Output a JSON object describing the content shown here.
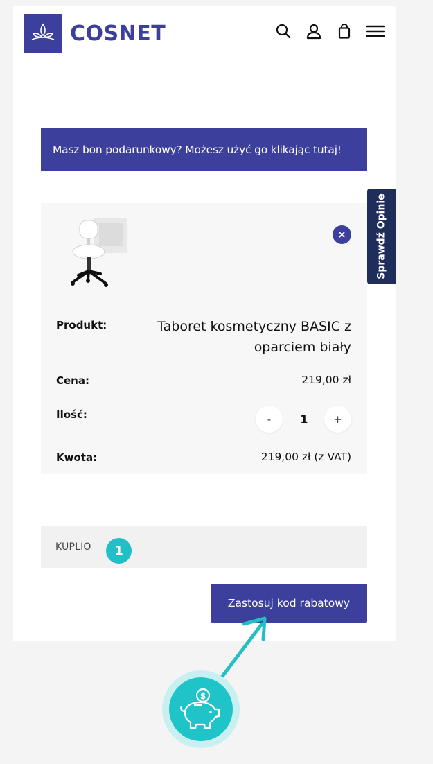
{
  "header": {
    "brand": "COSNET",
    "icons": [
      "search-icon",
      "account-icon",
      "bag-icon",
      "menu-icon"
    ]
  },
  "banner": {
    "text": "Masz bon podarunkowy? Możesz użyć go klikając tutaj!"
  },
  "side_tab": {
    "label": "Sprawdź Opinie"
  },
  "cart": {
    "product_label": "Produkt:",
    "product_name": "Taboret kosmetyczny BASIC z oparciem biały",
    "price_label": "Cena:",
    "price_value": "219,00 zł",
    "qty_label": "Ilość:",
    "qty_value": "1",
    "qty_minus": "-",
    "qty_plus": "+",
    "total_label": "Kwota:",
    "total_value": "219,00 zł (z VAT)",
    "remove_symbol": "×"
  },
  "coupon": {
    "code": "KUPLIO",
    "step_number": "1",
    "apply_label": "Zastosuj kod rabatowy"
  },
  "colors": {
    "brand": "#3d3f9c",
    "side_tab": "#1f2d5a",
    "annotation": "#22c0c6"
  }
}
